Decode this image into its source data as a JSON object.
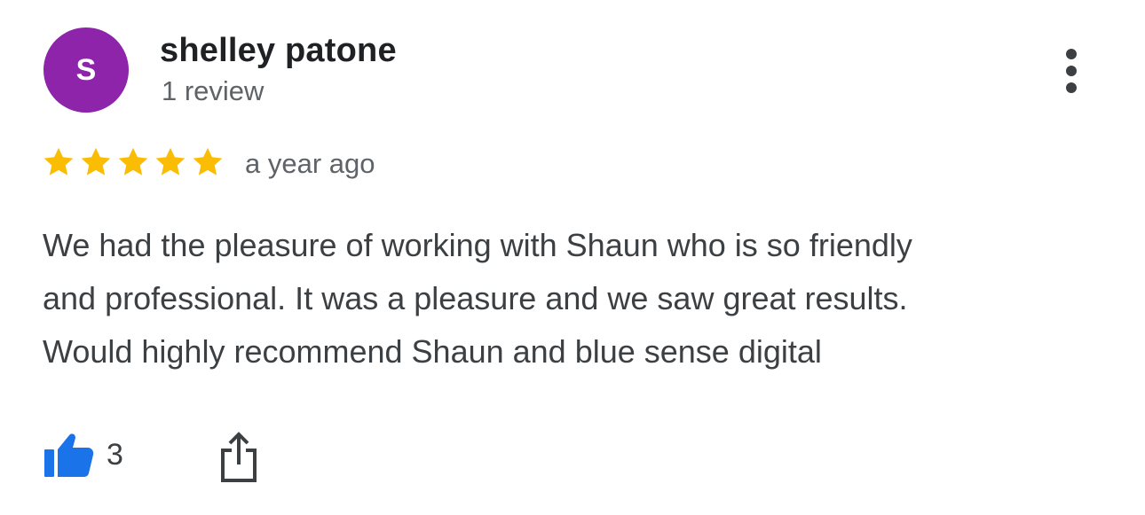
{
  "reviewer": {
    "avatar_initial": "S",
    "avatar_color": "#8e24aa",
    "name": "shelley patone",
    "review_count": "1 review"
  },
  "rating": {
    "stars": 5,
    "max_stars": 5,
    "star_color": "#fbbc04"
  },
  "review": {
    "time": "a year ago",
    "text_lines": [
      "We had the pleasure of working with Shaun who is so friendly",
      "and professional. It was a pleasure and we saw great results.",
      "Would highly recommend Shaun and blue sense digital"
    ]
  },
  "actions": {
    "like_count": "3",
    "like_icon": "thumbs-up-icon",
    "like_color": "#1a73e8",
    "share_icon": "share-icon",
    "more_icon": "more-vert-icon"
  }
}
